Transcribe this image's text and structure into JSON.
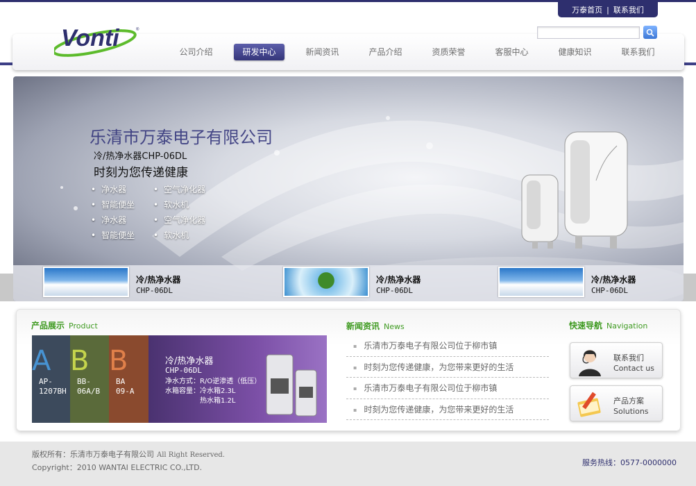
{
  "top_links": {
    "home": "万泰首页",
    "sep": "|",
    "contact": "联系我们"
  },
  "logo": {
    "text": "Vonti",
    "mark": "®"
  },
  "search": {
    "placeholder": ""
  },
  "nav": [
    {
      "label": "公司介绍",
      "active": false
    },
    {
      "label": "研发中心",
      "active": true
    },
    {
      "label": "新闻资讯",
      "active": false
    },
    {
      "label": "产品介绍",
      "active": false
    },
    {
      "label": "资质荣誉",
      "active": false
    },
    {
      "label": "客服中心",
      "active": false
    },
    {
      "label": "健康知识",
      "active": false
    },
    {
      "label": "联系我们",
      "active": false
    }
  ],
  "banner": {
    "company": "乐清市万泰电子有限公司",
    "model": "冷/热净水器CHP-06DL",
    "slogan": "时刻为您传递健康",
    "features": [
      "净水器",
      "空气净化器",
      "智能便坐",
      "软水机",
      "净水器",
      "空气净化器",
      "智能便坐",
      "软水机"
    ],
    "thumbs": [
      {
        "title": "冷/热净水器",
        "code": "CHP-06DL"
      },
      {
        "title": "冷/热净水器",
        "code": "CHP-06DL"
      },
      {
        "title": "冷/热净水器",
        "code": "CHP-06DL"
      }
    ]
  },
  "products": {
    "title": "产品展示",
    "title_en": "Product",
    "tabs": [
      {
        "letter": "A",
        "code1": "AP-",
        "code2": "1207BH",
        "color": "#3c4a5c"
      },
      {
        "letter": "B",
        "code1": "BB-",
        "code2": "06A/B",
        "color": "#5a6a3a"
      },
      {
        "letter": "B",
        "code1": "BA",
        "code2": "09-A",
        "color": "#8a4a2e"
      }
    ],
    "main_title": "冷/热净水器",
    "main_code": "CHP-06DL",
    "spec1": "净水方式：R/O逆渗透（低压）",
    "spec2": "水箱容量：冷水箱2.3L",
    "spec3": "热水箱1.2L"
  },
  "news": {
    "title": "新闻资讯",
    "title_en": "News",
    "items": [
      "乐清市万泰电子有限公司位于柳市镇",
      "时刻为您传递健康，为您带来更好的生活",
      "乐清市万泰电子有限公司位于柳市镇",
      "时刻为您传递健康，为您带来更好的生活"
    ]
  },
  "quick_nav": {
    "title": "快速导航",
    "title_en": "Navigation",
    "items": [
      {
        "cn": "联系我们",
        "en": "Contact us",
        "icon": "customer-service-icon"
      },
      {
        "cn": "产品方案",
        "en": "Solutions",
        "icon": "document-pencil-icon"
      }
    ]
  },
  "footer": {
    "copyright_label": "版权所有：乐清市万泰电子有限公司",
    "rights": "All Right Reserved.",
    "copyright_en": "Copyright：2010 WANTAI ELECTRIC CO.,LTD.",
    "hotline": "服务热线：0577-0000000"
  },
  "colors": {
    "brand": "#2e2f6e",
    "accent_green": "#3e9a20",
    "logo_green": "#5dbb2c"
  }
}
